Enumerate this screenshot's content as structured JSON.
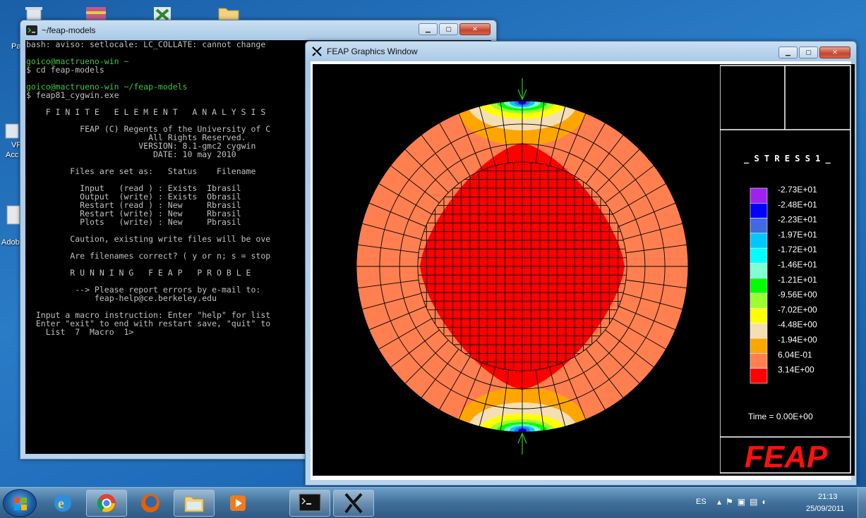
{
  "desktop": {
    "labels": [
      "Pa",
      "VP",
      "Acc",
      "Adob"
    ]
  },
  "terminal": {
    "title": "~/feap-models",
    "lines": [
      {
        "t": "bash: aviso: setlocale: LC_COLLATE: cannot change",
        "c": ""
      },
      {
        "t": "",
        "c": ""
      },
      {
        "t": "goico@mactrueno-win ~",
        "c": "g"
      },
      {
        "t": "$ cd feap-models",
        "c": ""
      },
      {
        "t": "",
        "c": ""
      },
      {
        "t": "goico@mactrueno-win ~/feap-models",
        "c": "g"
      },
      {
        "t": "$ feap81_cygwin.exe",
        "c": ""
      },
      {
        "t": "",
        "c": ""
      },
      {
        "t": "    F I N I T E   E L E M E N T   A N A L Y S I S",
        "c": ""
      },
      {
        "t": "",
        "c": ""
      },
      {
        "t": "           FEAP (C) Regents of the University of C",
        "c": ""
      },
      {
        "t": "                         All Rights Reserved.",
        "c": ""
      },
      {
        "t": "                       VERSION: 8.1-gmc2 cygwin",
        "c": ""
      },
      {
        "t": "                          DATE: 10 may 2010",
        "c": ""
      },
      {
        "t": "",
        "c": ""
      },
      {
        "t": "         Files are set as:   Status    Filename",
        "c": ""
      },
      {
        "t": "",
        "c": ""
      },
      {
        "t": "           Input   (read ) : Exists  Ibrasil",
        "c": ""
      },
      {
        "t": "           Output  (write) : Exists  Obrasil",
        "c": ""
      },
      {
        "t": "           Restart (read ) : New     Rbrasil",
        "c": ""
      },
      {
        "t": "           Restart (write) : New     Rbrasil",
        "c": ""
      },
      {
        "t": "           Plots   (write) : New     Pbrasil",
        "c": ""
      },
      {
        "t": "",
        "c": ""
      },
      {
        "t": "         Caution, existing write files will be ove",
        "c": ""
      },
      {
        "t": "",
        "c": ""
      },
      {
        "t": "         Are filenames correct? ( y or n; s = stop",
        "c": ""
      },
      {
        "t": "",
        "c": ""
      },
      {
        "t": "         R U N N I N G   F E A P   P R O B L E",
        "c": ""
      },
      {
        "t": "",
        "c": ""
      },
      {
        "t": "          --> Please report errors by e-mail to:",
        "c": ""
      },
      {
        "t": "              feap-help@ce.berkeley.edu",
        "c": ""
      },
      {
        "t": "",
        "c": ""
      },
      {
        "t": "  Input a macro instruction: Enter \"help\" for list",
        "c": ""
      },
      {
        "t": "  Enter \"exit\" to end with restart save, \"quit\" to",
        "c": ""
      },
      {
        "t": "    List  7  Macro  1>",
        "c": ""
      }
    ]
  },
  "graphics": {
    "title": "FEAP Graphics Window",
    "legend_title": "_ S T R E S S   1 _",
    "legend": [
      {
        "label": "-2.73E+01",
        "color": "#a020f0"
      },
      {
        "label": "-2.48E+01",
        "color": "#0000ff"
      },
      {
        "label": "-2.23E+01",
        "color": "#4169e1"
      },
      {
        "label": "-1.97E+01",
        "color": "#00c8ff"
      },
      {
        "label": "-1.72E+01",
        "color": "#00ffff"
      },
      {
        "label": "-1.46E+01",
        "color": "#7fffd4"
      },
      {
        "label": "-1.21E+01",
        "color": "#00ff00"
      },
      {
        "label": "-9.56E+00",
        "color": "#9aff32"
      },
      {
        "label": "-7.02E+00",
        "color": "#ffff00"
      },
      {
        "label": "-4.48E+00",
        "color": "#f5deb3"
      },
      {
        "label": "-1.94E+00",
        "color": "#ffa500"
      },
      {
        "label": "6.04E-01",
        "color": "#ff7f50"
      },
      {
        "label": "3.14E+00",
        "color": "#ff0000"
      }
    ],
    "time_label": "Time = 0.00E+00",
    "logo": "FEAP"
  },
  "taskbar": {
    "lang": "ES",
    "time": "21:13",
    "date": "25/09/2011"
  }
}
